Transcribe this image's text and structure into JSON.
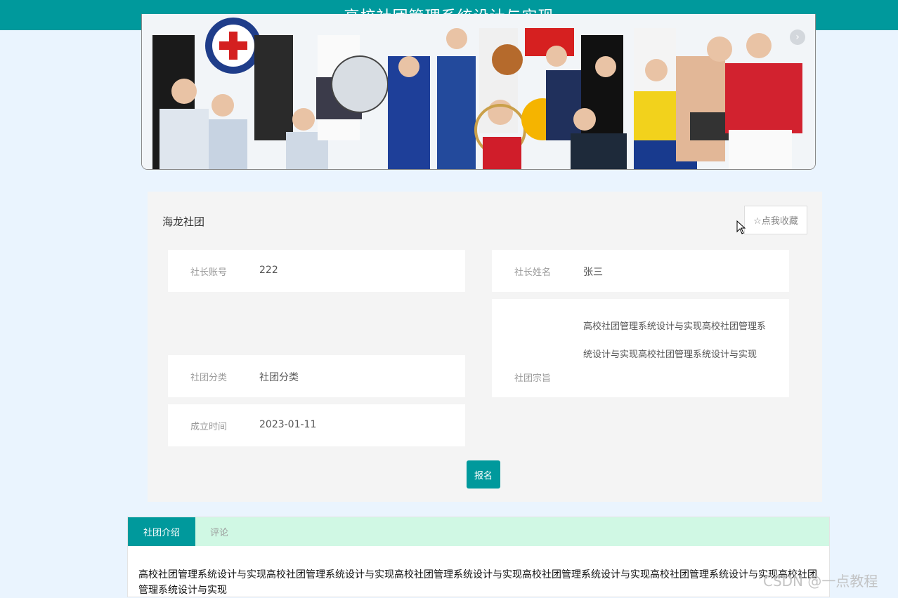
{
  "header": {
    "title": "高校社团管理系统设计与实现"
  },
  "banner": {
    "next_glyph": "›",
    "alt": "banner-image"
  },
  "club": {
    "name": "海龙社团",
    "favorite_label": "☆点我收藏",
    "fields": {
      "leader_account": {
        "label": "社长账号",
        "value": "222"
      },
      "leader_name": {
        "label": "社长姓名",
        "value": "张三"
      },
      "category": {
        "label": "社团分类",
        "value": "社团分类"
      },
      "purpose": {
        "label": "社团宗旨",
        "value": "高校社团管理系统设计与实现高校社团管理系统设计与实现高校社团管理系统设计与实现"
      },
      "founded": {
        "label": "成立时间",
        "value": "2023-01-11"
      }
    },
    "signup_label": "报名"
  },
  "tabs": [
    {
      "label": "社团介绍",
      "active": true
    },
    {
      "label": "评论",
      "active": false
    }
  ],
  "intro_text": "高校社团管理系统设计与实现高校社团管理系统设计与实现高校社团管理系统设计与实现高校社团管理系统设计与实现高校社团管理系统设计与实现高校社团管理系统设计与实现",
  "watermark": "CSDN @一点教程",
  "colors": {
    "primary": "#00999c",
    "page_bg": "#eaf4fe",
    "tab_bar_bg": "#d0f8e4",
    "card_bg": "#f4f4f4"
  }
}
